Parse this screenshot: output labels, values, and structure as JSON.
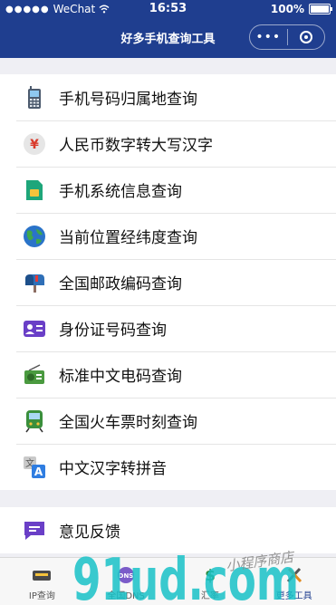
{
  "status": {
    "carrier": "WeChat",
    "time": "16:53",
    "battery": "100%"
  },
  "nav": {
    "title": "好多手机查询工具",
    "more": "•••"
  },
  "menu": [
    {
      "label": "手机号码归属地查询",
      "icon": "mobile-phone-icon"
    },
    {
      "label": "人民币数字转大写汉字",
      "icon": "yen-icon"
    },
    {
      "label": "手机系统信息查询",
      "icon": "sim-card-icon"
    },
    {
      "label": "当前位置经纬度查询",
      "icon": "globe-icon"
    },
    {
      "label": "全国邮政编码查询",
      "icon": "mailbox-icon"
    },
    {
      "label": "身份证号码查询",
      "icon": "id-card-icon"
    },
    {
      "label": "标准中文电码查询",
      "icon": "radio-icon"
    },
    {
      "label": "全国火车票时刻查询",
      "icon": "train-icon"
    },
    {
      "label": "中文汉字转拼音",
      "icon": "translate-icon"
    }
  ],
  "feedback": {
    "label": "意见反馈",
    "icon": "chat-bubble-icon"
  },
  "tabs": [
    {
      "label": "IP查询",
      "active": false
    },
    {
      "label": "全国DNS",
      "active": false
    },
    {
      "label": "汇率",
      "active": false
    },
    {
      "label": "更多工具",
      "active": true
    }
  ],
  "watermark": {
    "main": "91ud.com",
    "sub": "小程序商店"
  },
  "colors": {
    "nav": "#1f3e8f",
    "watermark": "#17c1c7"
  }
}
